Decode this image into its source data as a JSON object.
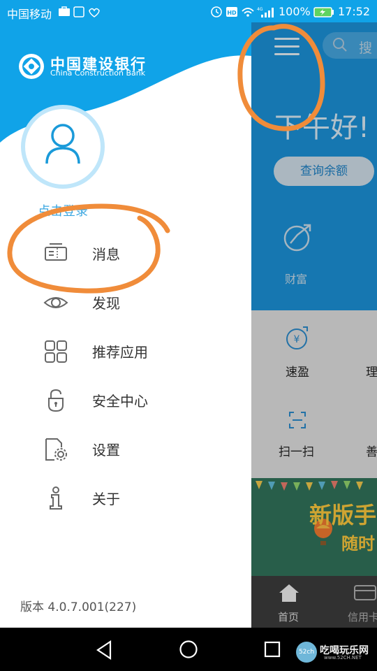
{
  "status_bar": {
    "carrier": "中国移动",
    "battery_percent": "100%",
    "time": "17:52"
  },
  "drawer": {
    "bank_name_cn": "中国建设银行",
    "bank_name_en": "China Construction Bank",
    "login_prompt": "点击登录",
    "menu": [
      {
        "label": "消息",
        "icon": "message-icon"
      },
      {
        "label": "发现",
        "icon": "eye-icon"
      },
      {
        "label": "推荐应用",
        "icon": "apps-grid-icon"
      },
      {
        "label": "安全中心",
        "icon": "lock-icon"
      },
      {
        "label": "设置",
        "icon": "settings-icon"
      },
      {
        "label": "关于",
        "icon": "info-icon"
      }
    ],
    "version": "版本 4.0.7.001(227)"
  },
  "main": {
    "search_placeholder": "搜",
    "greeting": "下午好!",
    "balance_button": "查询余额",
    "wealth_label": "财富",
    "quick_items": [
      {
        "label": "速盈"
      },
      {
        "label": "理"
      },
      {
        "label": "扫一扫"
      },
      {
        "label": "善"
      }
    ],
    "banner_title": "新版手",
    "banner_subtitle": "随时",
    "tabs": [
      {
        "label": "首页"
      },
      {
        "label": "信用卡"
      }
    ]
  },
  "watermark": {
    "badge": "52ch",
    "text": "吃喝玩乐网",
    "url": "www.52CH.NET"
  },
  "colors": {
    "brand_blue": "#10a3e8",
    "main_blue": "#1a8cd0",
    "annotation_orange": "#f08c3a"
  }
}
